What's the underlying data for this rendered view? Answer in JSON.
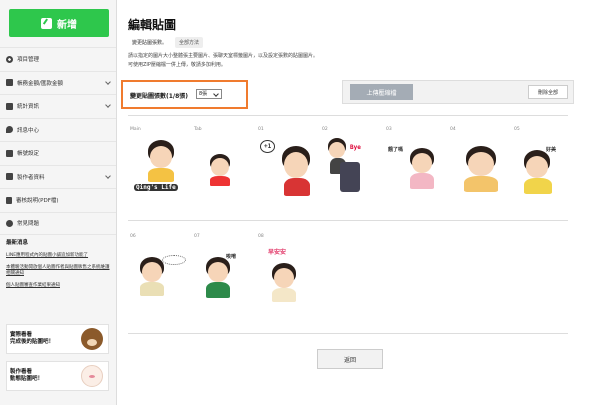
{
  "sidebar": {
    "new_button": "新增",
    "menu": [
      {
        "label": "項目管理",
        "icon": "gear-icon",
        "chevron": ""
      },
      {
        "label": "帳務金額/匯款金額",
        "icon": "coin-icon",
        "chevron": "down"
      },
      {
        "label": "統計資訊",
        "icon": "chart-icon",
        "chevron": "down"
      },
      {
        "label": "訊息中心",
        "icon": "mail-icon",
        "chevron": ""
      },
      {
        "label": "帳號設定",
        "icon": "user-icon",
        "chevron": ""
      },
      {
        "label": "製作者資料",
        "icon": "person-icon",
        "chevron": "down"
      },
      {
        "label": "審核說明(PDF檔)",
        "icon": "doc-icon",
        "chevron": ""
      },
      {
        "label": "常見問題",
        "icon": "question-icon",
        "chevron": ""
      }
    ],
    "news_title": "最新消息",
    "news": [
      "LINE應用程式內的貼圖小舖追加新功能了",
      "本體驗活動開放個人貼圖作者與貼圖販售之系統維護相關通知",
      "個人貼圖審查作業結果通知"
    ],
    "promos": [
      {
        "line1": "實際看看",
        "line2": "完成後的貼圖吧！",
        "icon": "brown-bear-icon"
      },
      {
        "line1": "製作看看",
        "line2": "動態貼圖吧！",
        "icon": "cony-bunny-icon"
      }
    ]
  },
  "main": {
    "title": "編輯貼圖",
    "tabs": [
      {
        "label": "變更貼圖張數。",
        "active": true
      },
      {
        "label": "全部方法",
        "active": false
      }
    ],
    "description": [
      "請以指定的圖片大小整體張主要圖片、張聊天室標籤圖片，以及設定張數的貼圖圖片。",
      "可使用ZIP壓縮檔一併上傳，敬請多加利用。"
    ],
    "count_label": "變更貼圖張數(1/8張)",
    "count_value": "8張",
    "upload_button": "上傳壓縮檔",
    "delete_all_button": "刪除全部",
    "back_button": "返回",
    "stickers_row1": [
      {
        "label": "Main",
        "caption": "Qing's Life"
      },
      {
        "label": "Tab",
        "caption": ""
      },
      {
        "label": "01",
        "caption": "+1"
      },
      {
        "label": "02",
        "caption": "Bye"
      },
      {
        "label": "03",
        "caption": "餓了嗎"
      },
      {
        "label": "04",
        "caption": ""
      },
      {
        "label": "05",
        "caption": "好美"
      }
    ],
    "stickers_row2": [
      {
        "label": "06",
        "caption": ""
      },
      {
        "label": "07",
        "caption": "唉唷"
      },
      {
        "label": "08",
        "caption": "早安安"
      }
    ]
  }
}
